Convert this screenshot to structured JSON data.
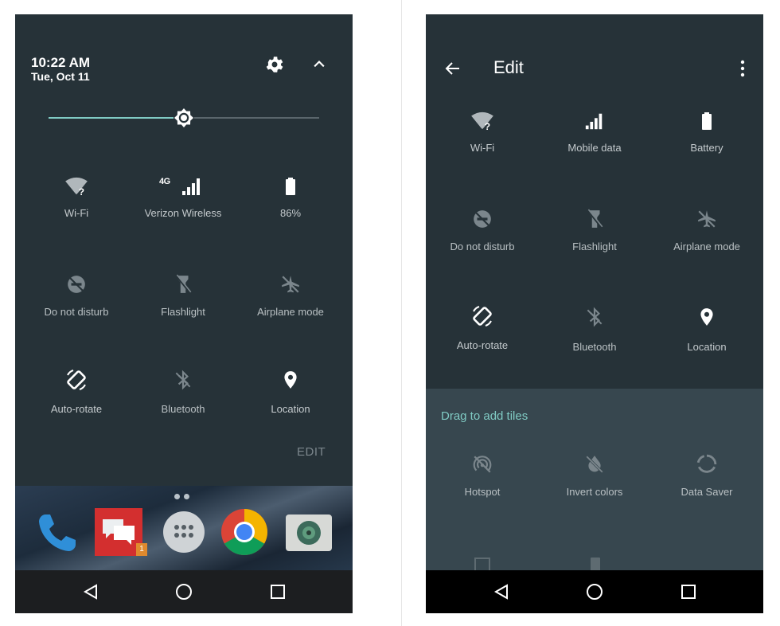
{
  "left_screen": {
    "status": {
      "time": "10:22 AM",
      "date": "Tue, Oct 11"
    },
    "header_icons": [
      "gear-icon",
      "chevron-up-icon"
    ],
    "brightness": {
      "level_percent": 50
    },
    "tiles": [
      {
        "name": "wifi",
        "label": "Wi-Fi",
        "icon": "wifi-question-icon",
        "active": true
      },
      {
        "name": "mobile-data",
        "label": "Verizon Wireless",
        "icon": "signal-4g-icon",
        "badge": "4G",
        "active": true
      },
      {
        "name": "battery",
        "label": "86%",
        "icon": "battery-icon",
        "active": true
      },
      {
        "name": "do-not-disturb",
        "label": "Do not disturb",
        "icon": "do-not-disturb-icon",
        "active": false
      },
      {
        "name": "flashlight",
        "label": "Flashlight",
        "icon": "flashlight-icon",
        "active": false
      },
      {
        "name": "airplane-mode",
        "label": "Airplane mode",
        "icon": "airplane-icon",
        "active": false
      },
      {
        "name": "auto-rotate",
        "label": "Auto-rotate",
        "icon": "rotate-icon",
        "active": true
      },
      {
        "name": "bluetooth",
        "label": "Bluetooth",
        "icon": "bluetooth-icon",
        "active": false
      },
      {
        "name": "location",
        "label": "Location",
        "icon": "location-pin-icon",
        "active": true
      }
    ],
    "edit_label": "EDIT",
    "dock_apps": [
      "phone-app-icon",
      "messages-app-icon",
      "app-drawer-icon",
      "chrome-app-icon",
      "camera-app-icon"
    ],
    "messages_badge": "1"
  },
  "right_screen": {
    "title": "Edit",
    "active_tiles": [
      {
        "name": "wifi",
        "label": "Wi-Fi",
        "icon": "wifi-question-icon"
      },
      {
        "name": "mobile-data",
        "label": "Mobile data",
        "icon": "signal-icon"
      },
      {
        "name": "battery",
        "label": "Battery",
        "icon": "battery-icon"
      },
      {
        "name": "do-not-disturb",
        "label": "Do not disturb",
        "icon": "do-not-disturb-icon"
      },
      {
        "name": "flashlight",
        "label": "Flashlight",
        "icon": "flashlight-icon"
      },
      {
        "name": "airplane-mode",
        "label": "Airplane mode",
        "icon": "airplane-icon"
      },
      {
        "name": "auto-rotate",
        "label": "Auto-rotate",
        "icon": "rotate-icon"
      },
      {
        "name": "bluetooth",
        "label": "Bluetooth",
        "icon": "bluetooth-icon"
      },
      {
        "name": "location",
        "label": "Location",
        "icon": "location-pin-icon"
      }
    ],
    "drag_label": "Drag to add tiles",
    "available_tiles": [
      {
        "name": "hotspot",
        "label": "Hotspot",
        "icon": "hotspot-icon"
      },
      {
        "name": "invert-colors",
        "label": "Invert colors",
        "icon": "invert-colors-icon"
      },
      {
        "name": "data-saver",
        "label": "Data Saver",
        "icon": "data-saver-icon"
      }
    ]
  },
  "nav_bar": [
    "back-icon",
    "home-icon",
    "recents-icon"
  ],
  "colors": {
    "panel": "#263238",
    "add_panel": "#37474f",
    "accent": "#80cbc4",
    "inactive_icon": "#7b868c"
  }
}
